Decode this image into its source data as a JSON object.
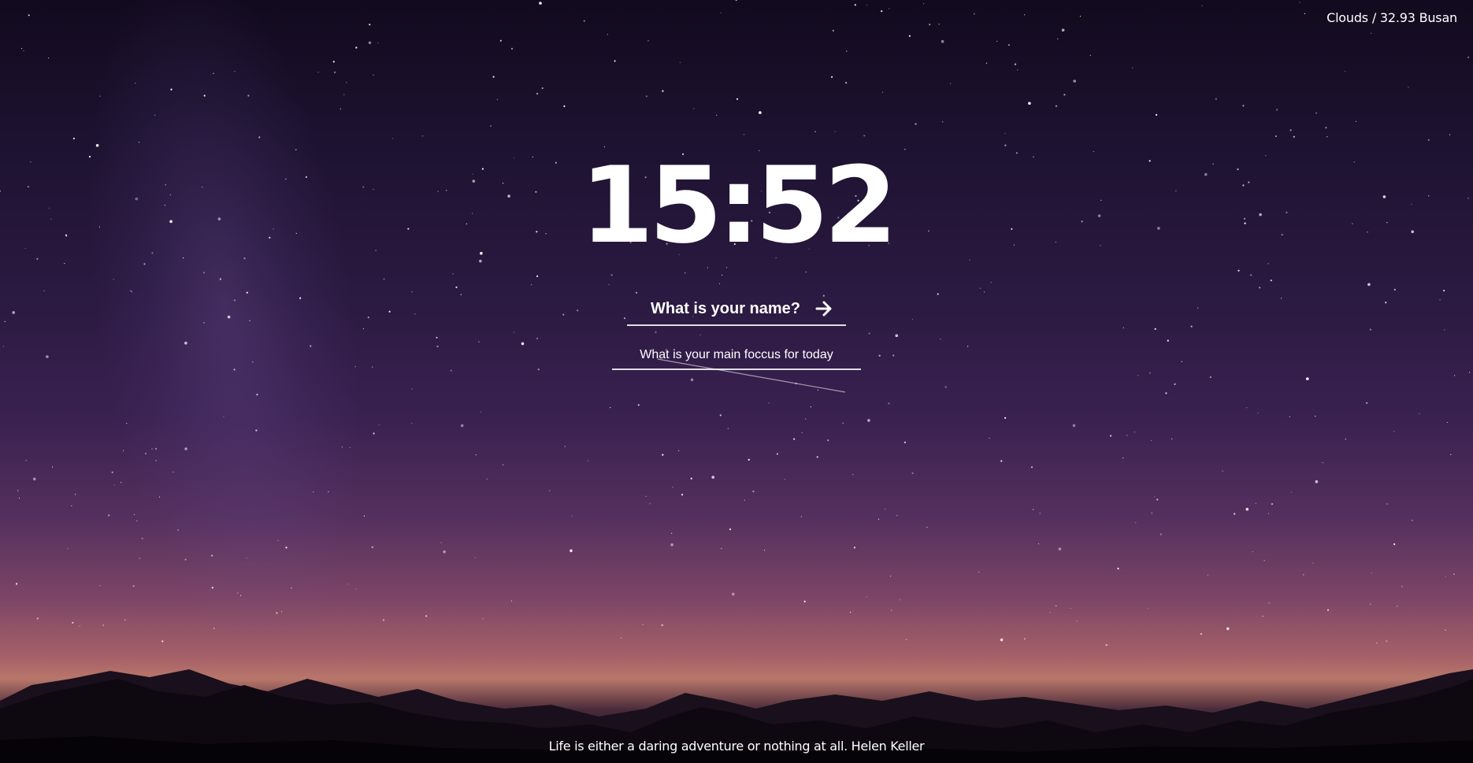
{
  "weather": {
    "text": "Clouds / 32.93 Busan"
  },
  "clock": {
    "time": "15:52"
  },
  "name_prompt": {
    "placeholder": "What is your name?",
    "submit_icon": "arrow-right-icon"
  },
  "focus_prompt": {
    "placeholder": "What is your main foccus for today"
  },
  "quote": {
    "text": "Life is either a daring adventure or nothing at all. Helen Keller"
  },
  "colors": {
    "text": "#ffffff",
    "sky_top": "#120a1e",
    "sky_horizon": "#b8766a",
    "mountains": "#130b14"
  }
}
